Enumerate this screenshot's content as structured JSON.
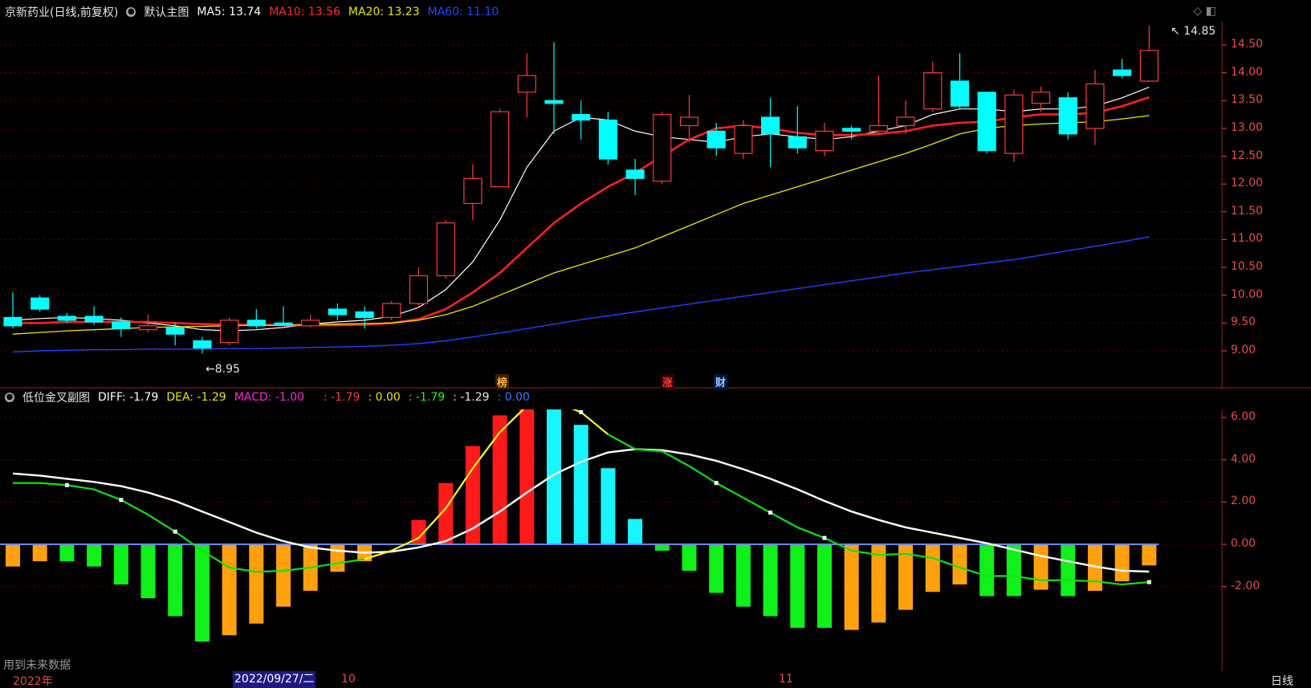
{
  "main_header": {
    "title": "京新药业(日线,前复权)",
    "template": "默认主图",
    "ma5": "MA5: 13.74",
    "ma10": "MA10: 13.56",
    "ma20": "MA20: 13.23",
    "ma60": "MA60: 11.10"
  },
  "sub_header": {
    "title": "低位金叉副图",
    "diff": "DIFF: -1.79",
    "dea": "DEA: -1.29",
    "macd": "MACD: -1.00",
    "v1": ": -1.79",
    "v2": ": 0.00",
    "v3": ": -1.79",
    "v4": ": -1.29",
    "v5": ": 0.00"
  },
  "annotations": {
    "high": "14.85",
    "low": "8.95",
    "tag_bang": "榜",
    "tag_zhang": "涨",
    "tag_cai": "财"
  },
  "bottom": {
    "future_note": "用到未来数据",
    "year": "2022年",
    "date_highlight": "2022/09/27/二",
    "month_10": "10",
    "month_11": "11",
    "period": "日线"
  },
  "colors": {
    "up": "#ff3b3b",
    "down": "#00ffff",
    "ma5": "#ffffff",
    "ma10": "#ff2020",
    "ma20": "#e8e800",
    "ma60": "#2040ff",
    "axis": "#e84c4c",
    "grid": "#5a0000"
  },
  "chart_data": [
    {
      "type": "candlestick",
      "title": "京新药业(日线,前复权)",
      "ylim": [
        8.7,
        14.95
      ],
      "y_ticks": [
        9.0,
        9.5,
        10.0,
        10.5,
        11.0,
        11.5,
        12.0,
        12.5,
        13.0,
        13.5,
        14.0,
        14.5
      ],
      "candles": [
        {
          "o": 9.6,
          "c": 9.45,
          "h": 10.05,
          "l": 9.4
        },
        {
          "o": 9.95,
          "c": 9.75,
          "h": 10.0,
          "l": 9.7
        },
        {
          "o": 9.62,
          "c": 9.55,
          "h": 9.68,
          "l": 9.5
        },
        {
          "o": 9.62,
          "c": 9.52,
          "h": 9.8,
          "l": 9.47
        },
        {
          "o": 9.52,
          "c": 9.4,
          "h": 9.6,
          "l": 9.25
        },
        {
          "o": 9.38,
          "c": 9.45,
          "h": 9.65,
          "l": 9.33
        },
        {
          "o": 9.42,
          "c": 9.3,
          "h": 9.5,
          "l": 9.1
        },
        {
          "o": 9.18,
          "c": 9.05,
          "h": 9.25,
          "l": 8.95
        },
        {
          "o": 9.15,
          "c": 9.55,
          "h": 9.6,
          "l": 9.1
        },
        {
          "o": 9.55,
          "c": 9.45,
          "h": 9.75,
          "l": 9.4
        },
        {
          "o": 9.5,
          "c": 9.49,
          "h": 9.8,
          "l": 9.45
        },
        {
          "o": 9.45,
          "c": 9.55,
          "h": 9.65,
          "l": 9.42
        },
        {
          "o": 9.75,
          "c": 9.65,
          "h": 9.85,
          "l": 9.55
        },
        {
          "o": 9.7,
          "c": 9.6,
          "h": 9.8,
          "l": 9.4
        },
        {
          "o": 9.6,
          "c": 9.85,
          "h": 9.9,
          "l": 9.55
        },
        {
          "o": 9.85,
          "c": 10.35,
          "h": 10.5,
          "l": 9.8
        },
        {
          "o": 10.35,
          "c": 11.3,
          "h": 11.35,
          "l": 10.3
        },
        {
          "o": 11.65,
          "c": 12.1,
          "h": 12.35,
          "l": 11.35
        },
        {
          "o": 11.95,
          "c": 13.3,
          "h": 13.35,
          "l": 11.95
        },
        {
          "o": 13.65,
          "c": 13.95,
          "h": 14.35,
          "l": 13.2
        },
        {
          "o": 13.5,
          "c": 13.45,
          "h": 14.55,
          "l": 12.9
        },
        {
          "o": 13.25,
          "c": 13.15,
          "h": 13.5,
          "l": 12.8
        },
        {
          "o": 13.15,
          "c": 12.45,
          "h": 13.3,
          "l": 12.35
        },
        {
          "o": 12.25,
          "c": 12.1,
          "h": 12.45,
          "l": 11.8
        },
        {
          "o": 12.05,
          "c": 13.25,
          "h": 13.3,
          "l": 12.0
        },
        {
          "o": 13.05,
          "c": 13.2,
          "h": 13.6,
          "l": 12.75
        },
        {
          "o": 12.95,
          "c": 12.65,
          "h": 13.1,
          "l": 12.5
        },
        {
          "o": 12.55,
          "c": 13.05,
          "h": 13.15,
          "l": 12.45
        },
        {
          "o": 13.2,
          "c": 12.9,
          "h": 13.55,
          "l": 12.3
        },
        {
          "o": 12.85,
          "c": 12.65,
          "h": 13.4,
          "l": 12.55
        },
        {
          "o": 12.6,
          "c": 12.95,
          "h": 13.1,
          "l": 12.5
        },
        {
          "o": 13.0,
          "c": 12.95,
          "h": 13.05,
          "l": 12.8
        },
        {
          "o": 12.95,
          "c": 13.05,
          "h": 13.95,
          "l": 12.9
        },
        {
          "o": 13.05,
          "c": 13.2,
          "h": 13.5,
          "l": 12.9
        },
        {
          "o": 13.35,
          "c": 14.0,
          "h": 14.2,
          "l": 13.3
        },
        {
          "o": 13.85,
          "c": 13.4,
          "h": 14.35,
          "l": 13.35
        },
        {
          "o": 13.65,
          "c": 12.6,
          "h": 13.65,
          "l": 12.55
        },
        {
          "o": 12.55,
          "c": 13.6,
          "h": 13.7,
          "l": 12.4
        },
        {
          "o": 13.45,
          "c": 13.65,
          "h": 13.75,
          "l": 13.3
        },
        {
          "o": 13.55,
          "c": 12.9,
          "h": 13.65,
          "l": 12.8
        },
        {
          "o": 13.0,
          "c": 13.8,
          "h": 14.05,
          "l": 12.7
        },
        {
          "o": 14.05,
          "c": 13.95,
          "h": 14.25,
          "l": 13.9
        },
        {
          "o": 13.85,
          "c": 14.4,
          "h": 14.85,
          "l": 13.85
        }
      ],
      "series": [
        {
          "name": "MA5",
          "values": [
            9.55,
            9.58,
            9.6,
            9.58,
            9.55,
            9.5,
            9.45,
            9.38,
            9.36,
            9.38,
            9.42,
            9.48,
            9.52,
            9.55,
            9.62,
            9.78,
            10.1,
            10.6,
            11.35,
            12.3,
            12.95,
            13.2,
            13.15,
            12.95,
            12.85,
            12.8,
            12.75,
            12.85,
            12.9,
            12.85,
            12.8,
            12.85,
            12.95,
            13.05,
            13.25,
            13.35,
            13.35,
            13.3,
            13.35,
            13.35,
            13.4,
            13.55,
            13.74
          ]
        },
        {
          "name": "MA10",
          "values": [
            9.5,
            9.5,
            9.52,
            9.52,
            9.52,
            9.52,
            9.5,
            9.48,
            9.47,
            9.47,
            9.46,
            9.46,
            9.46,
            9.47,
            9.5,
            9.57,
            9.75,
            10.05,
            10.4,
            10.85,
            11.3,
            11.65,
            11.95,
            12.2,
            12.5,
            12.8,
            13.0,
            13.05,
            13.0,
            12.92,
            12.88,
            12.88,
            12.9,
            12.95,
            13.05,
            13.1,
            13.12,
            13.2,
            13.25,
            13.25,
            13.28,
            13.4,
            13.56
          ]
        },
        {
          "name": "MA20",
          "values": [
            9.3,
            9.33,
            9.36,
            9.38,
            9.4,
            9.42,
            9.43,
            9.44,
            9.45,
            9.46,
            9.46,
            9.47,
            9.48,
            9.49,
            9.5,
            9.55,
            9.65,
            9.8,
            10.0,
            10.2,
            10.4,
            10.55,
            10.7,
            10.85,
            11.05,
            11.25,
            11.45,
            11.65,
            11.8,
            11.95,
            12.1,
            12.25,
            12.4,
            12.55,
            12.72,
            12.9,
            13.0,
            13.05,
            13.08,
            13.1,
            13.12,
            13.17,
            13.23
          ]
        },
        {
          "name": "MA60",
          "values": [
            8.98,
            9.0,
            9.01,
            9.02,
            9.02,
            9.03,
            9.03,
            9.03,
            9.04,
            9.04,
            9.05,
            9.06,
            9.07,
            9.08,
            9.1,
            9.13,
            9.18,
            9.25,
            9.32,
            9.4,
            9.48,
            9.56,
            9.63,
            9.7,
            9.77,
            9.84,
            9.91,
            9.98,
            10.05,
            10.12,
            10.19,
            10.26,
            10.33,
            10.4,
            10.46,
            10.52,
            10.58,
            10.64,
            10.72,
            10.8,
            10.88,
            10.96,
            11.05
          ]
        }
      ]
    },
    {
      "type": "bar",
      "title": "低位金叉副图",
      "ylim": [
        -4.6,
        7.4
      ],
      "y_ticks": [
        -2.0,
        0.0,
        2.0,
        4.0,
        6.0
      ],
      "values": [
        -1.05,
        -0.8,
        -0.8,
        -1.05,
        -1.9,
        -2.55,
        -3.4,
        -4.6,
        -4.3,
        -3.75,
        -2.95,
        -2.2,
        -1.3,
        -0.8,
        0.0,
        1.15,
        2.9,
        4.65,
        6.1,
        7.1,
        6.85,
        5.65,
        3.6,
        1.2,
        -0.3,
        -1.25,
        -2.3,
        -2.95,
        -3.4,
        -3.95,
        -3.95,
        -4.05,
        -3.7,
        -3.1,
        -2.25,
        -1.9,
        -2.45,
        -2.45,
        -2.15,
        -2.45,
        -2.2,
        -1.75,
        -1.0
      ],
      "bar_colors": [
        "orange",
        "orange",
        "green",
        "green",
        "green",
        "green",
        "green",
        "green",
        "orange",
        "orange",
        "orange",
        "orange",
        "orange",
        "orange",
        "orange",
        "red",
        "red",
        "red",
        "red",
        "red",
        "cyan",
        "cyan",
        "cyan",
        "cyan",
        "green",
        "green",
        "green",
        "green",
        "green",
        "green",
        "green",
        "orange",
        "orange",
        "orange",
        "orange",
        "orange",
        "green",
        "green",
        "orange",
        "green",
        "orange",
        "orange",
        "orange"
      ],
      "series": [
        {
          "name": "DIFF",
          "values": [
            2.9,
            2.9,
            2.8,
            2.6,
            2.1,
            1.4,
            0.6,
            -0.3,
            -1.1,
            -1.3,
            -1.25,
            -1.1,
            -0.9,
            -0.7,
            -0.3,
            0.3,
            1.7,
            3.6,
            5.3,
            6.55,
            6.75,
            6.25,
            5.2,
            4.5,
            4.4,
            3.7,
            2.9,
            2.2,
            1.5,
            0.8,
            0.3,
            -0.3,
            -0.5,
            -0.45,
            -0.65,
            -1.1,
            -1.5,
            -1.5,
            -1.7,
            -1.7,
            -1.75,
            -1.9,
            -1.79
          ]
        },
        {
          "name": "DEA",
          "values": [
            3.35,
            3.25,
            3.1,
            2.95,
            2.75,
            2.45,
            2.05,
            1.55,
            1.05,
            0.55,
            0.15,
            -0.15,
            -0.3,
            -0.4,
            -0.35,
            -0.15,
            0.15,
            0.75,
            1.55,
            2.45,
            3.3,
            3.9,
            4.35,
            4.5,
            4.45,
            4.25,
            3.95,
            3.55,
            3.1,
            2.6,
            2.05,
            1.55,
            1.15,
            0.8,
            0.55,
            0.3,
            0.05,
            -0.25,
            -0.55,
            -0.8,
            -1.05,
            -1.25,
            -1.29
          ]
        }
      ]
    }
  ]
}
